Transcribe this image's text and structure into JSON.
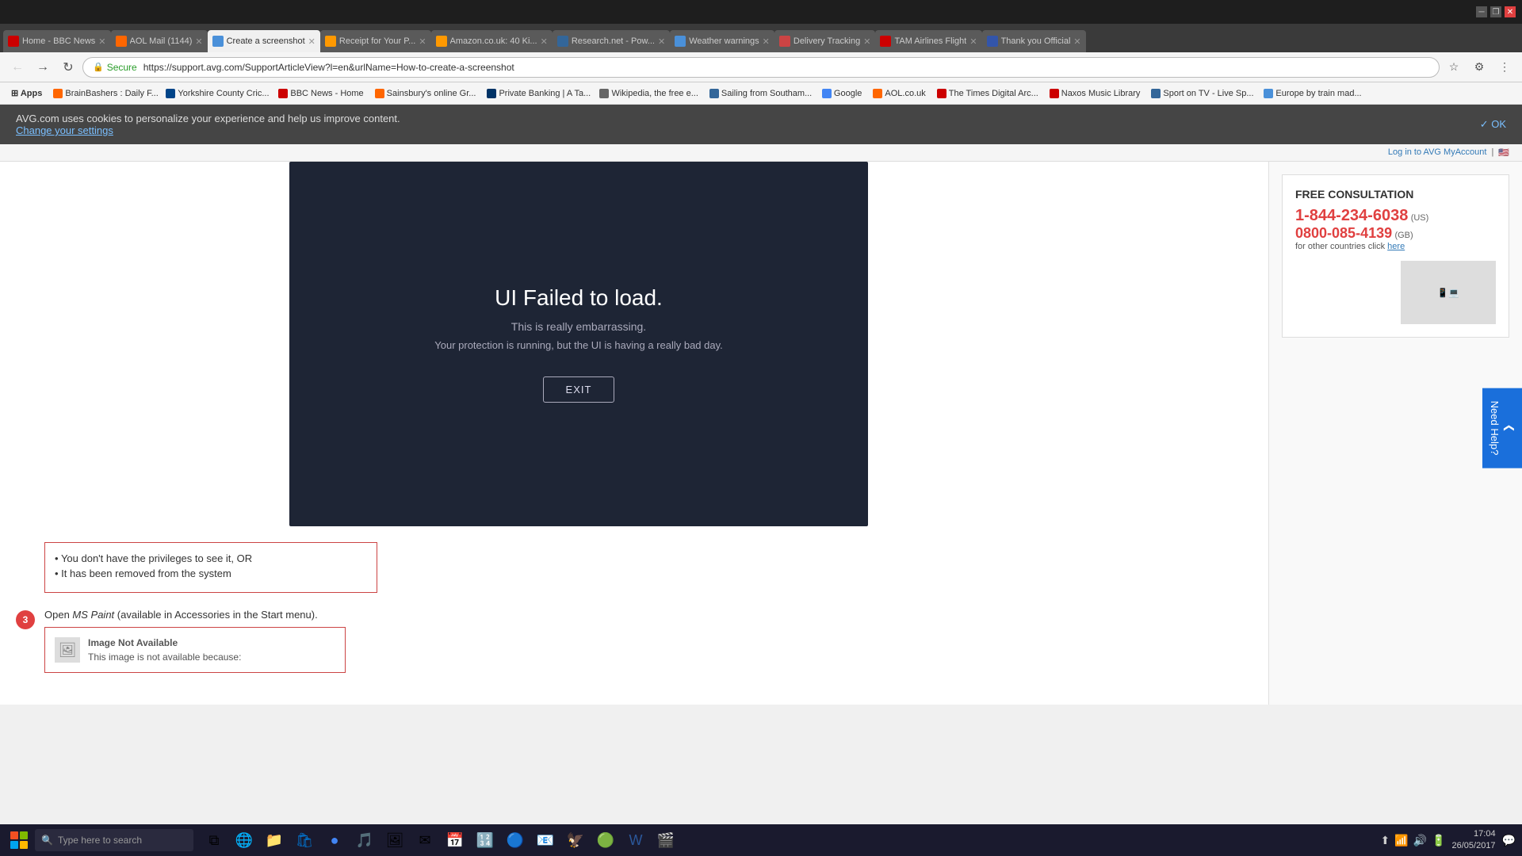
{
  "titlebar": {
    "minimize_label": "─",
    "restore_label": "❐",
    "close_label": "✕"
  },
  "tabs": [
    {
      "id": "tab-bbc",
      "label": "Home - BBC News",
      "favicon_color": "#cc0000",
      "active": false,
      "closeable": true
    },
    {
      "id": "tab-aol",
      "label": "AOL Mail (1144)",
      "favicon_color": "#ff6600",
      "active": false,
      "closeable": true
    },
    {
      "id": "tab-screenshot",
      "label": "Create a screenshot",
      "favicon_color": "#4a90d9",
      "active": true,
      "closeable": true
    },
    {
      "id": "tab-receipt",
      "label": "Receipt for Your P...",
      "favicon_color": "#ff9900",
      "active": false,
      "closeable": true
    },
    {
      "id": "tab-amazon",
      "label": "Amazon.co.uk: 40 Ki...",
      "favicon_color": "#ff9900",
      "active": false,
      "closeable": true
    },
    {
      "id": "tab-research",
      "label": "Research.net - Pow...",
      "favicon_color": "#336699",
      "active": false,
      "closeable": true
    },
    {
      "id": "tab-weather",
      "label": "Weather warnings",
      "favicon_color": "#4a90d9",
      "active": false,
      "closeable": true
    },
    {
      "id": "tab-delivery",
      "label": "Delivery Tracking",
      "favicon_color": "#cc4444",
      "active": false,
      "closeable": true
    },
    {
      "id": "tab-tam",
      "label": "TAM Airlines Flight",
      "favicon_color": "#cc0000",
      "active": false,
      "closeable": true
    },
    {
      "id": "tab-thankyou",
      "label": "Thank you Official",
      "favicon_color": "#3355aa",
      "active": false,
      "closeable": true
    }
  ],
  "toolbar": {
    "back_label": "←",
    "forward_label": "→",
    "reload_label": "↻",
    "secure_label": "🔒 Secure",
    "url": "https://support.avg.com/SupportArticleView?l=en&urlName=How-to-create-a-screenshot",
    "bookmark_label": "☆",
    "extensions_label": "⚙",
    "menu_label": "⋮"
  },
  "bookmarks": [
    {
      "label": "BrainBashers : Daily F...",
      "color": "#ff6600"
    },
    {
      "label": "Yorkshire County Cric...",
      "color": "#004488"
    },
    {
      "label": "BBC News - Home",
      "color": "#cc0000"
    },
    {
      "label": "Sainsbury's online Gr...",
      "color": "#ff6600"
    },
    {
      "label": "Private Banking | A Ta...",
      "color": "#003366"
    },
    {
      "label": "Wikipedia, the free e...",
      "color": "#666"
    },
    {
      "label": "Sailing from Southam...",
      "color": "#336699"
    },
    {
      "label": "Google",
      "color": "#4285f4"
    },
    {
      "label": "AOL.co.uk",
      "color": "#ff6600"
    },
    {
      "label": "The Times Digital Arc...",
      "color": "#cc0000"
    },
    {
      "label": "Naxos Music Library",
      "color": "#cc0000"
    },
    {
      "label": "Sport on TV - Live Sp...",
      "color": "#336699"
    },
    {
      "label": "Europe by train mad...",
      "color": "#4a90d9"
    }
  ],
  "cookie_banner": {
    "text": "AVG.com uses cookies to personalize your experience and help us improve content.",
    "link_text": "Change your settings",
    "ok_label": "✓ OK"
  },
  "login_bar": {
    "text": "Log in to AVG MyAccount",
    "separator": "|",
    "flag": "🇺🇸"
  },
  "modal": {
    "title": "UI Failed to load.",
    "subtitle": "This is really embarrassing.",
    "description": "Your protection is running, but the UI is having a really bad day.",
    "exit_label": "EXIT"
  },
  "page_content": {
    "step3_label": "3",
    "step3_text": "Open MS Paint (available in Accessories in the Start menu).",
    "image_not_available_title": "Image Not Available",
    "image_not_available_text": "This image is not available because:",
    "bullet1": "You don't have the privileges to see it, OR",
    "bullet2": "It has been removed from the system"
  },
  "sidebar": {
    "consultation_title": "FREE CONSULTATION",
    "phone_us": "1-844-234-6038",
    "phone_us_label": "(US)",
    "phone_gb": "0800-085-4139",
    "phone_gb_label": "(GB)",
    "other_countries_text": "for other countries click",
    "here_label": "here"
  },
  "need_help": {
    "arrow_label": "❮",
    "text": "Need Help?"
  },
  "taskbar": {
    "search_placeholder": "Type here to search",
    "time": "17:04",
    "date": "26/05/2017"
  }
}
